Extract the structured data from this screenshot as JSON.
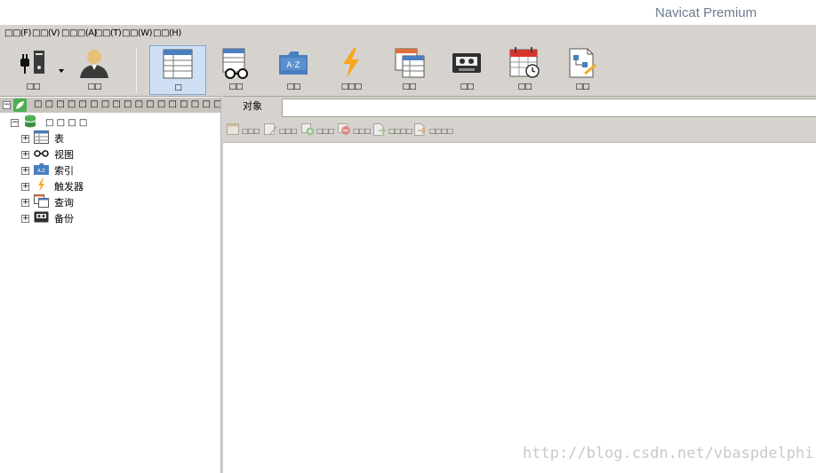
{
  "window": {
    "title": "Navicat Premium"
  },
  "menu": [
    {
      "label": "□□(F)"
    },
    {
      "label": "□□(V)"
    },
    {
      "label": "□□□(A)"
    },
    {
      "label": "□□(T)"
    },
    {
      "label": "□□(W)"
    },
    {
      "label": "□□(H)"
    }
  ],
  "toolbar": {
    "buttons": [
      {
        "label": "□□",
        "icon": "connection-icon"
      },
      {
        "label": "□□",
        "icon": "user-icon"
      },
      {
        "label": "□",
        "icon": "table-icon"
      },
      {
        "label": "□□",
        "icon": "view-icon"
      },
      {
        "label": "□□",
        "icon": "index-icon"
      },
      {
        "label": "□□□",
        "icon": "trigger-icon"
      },
      {
        "label": "□□",
        "icon": "query-icon"
      },
      {
        "label": "□□",
        "icon": "backup-icon"
      },
      {
        "label": "□□",
        "icon": "schedule-icon"
      },
      {
        "label": "□□",
        "icon": "model-icon"
      }
    ]
  },
  "nav": {
    "root_label": "□ □ □ □ □ □ □ □ □ □ □ □ □ □ □ □ □ □ □ □ □",
    "database_label": "□ □ □ □",
    "items": [
      {
        "label": "表",
        "icon": "table-icon"
      },
      {
        "label": "视图",
        "icon": "view-icon"
      },
      {
        "label": "索引",
        "icon": "index-icon"
      },
      {
        "label": "触发器",
        "icon": "trigger-icon"
      },
      {
        "label": "查询",
        "icon": "query-icon"
      },
      {
        "label": "备份",
        "icon": "backup-icon"
      }
    ]
  },
  "content": {
    "tab_label": "对象",
    "object_buttons": [
      {
        "label": "□□□"
      },
      {
        "label": "□□□"
      },
      {
        "label": "□□□"
      },
      {
        "label": "□□□"
      },
      {
        "label": "□□□□"
      },
      {
        "label": "□□□□"
      }
    ]
  },
  "watermark": "http://blog.csdn.net/vbaspdelphi",
  "colors": {
    "title_text": "#6b7a8f",
    "chrome": "#d6d3ce",
    "active_tool": "#cfe0f5",
    "trigger_yellow": "#f7a71b",
    "index_blue": "#4a7fbf"
  }
}
